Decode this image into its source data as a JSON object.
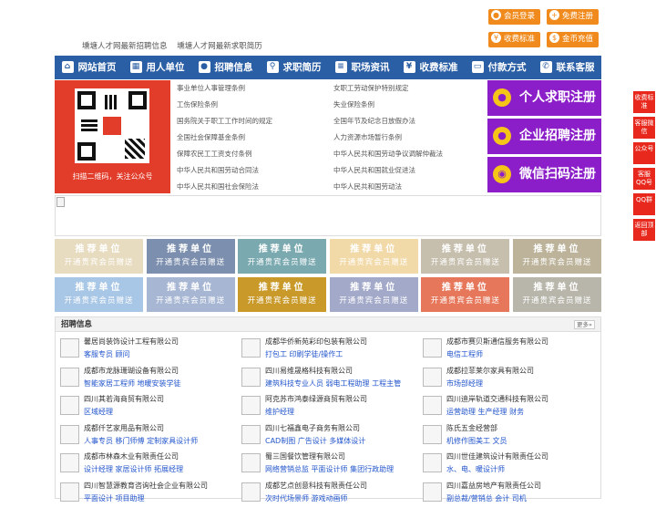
{
  "top_buttons": {
    "member_login": "会员登录",
    "free_register": "免费注册",
    "fee_standard": "收费标准",
    "coin_recharge": "金币充值"
  },
  "top_links": [
    "壎塘人才网最新招聘信息",
    "壎塘人才网最新求职简历"
  ],
  "nav": [
    "网站首页",
    "用人单位",
    "招聘信息",
    "求职简历",
    "职场资讯",
    "收费标准",
    "付款方式",
    "联系客服"
  ],
  "qr_caption": "扫描二维码，关注公众号",
  "laws": [
    [
      "事业单位人事管理条例",
      "女职工劳动保护特别规定"
    ],
    [
      "工伤保险条例",
      "失业保险条例"
    ],
    [
      "国务院关于职工工作时间的规定",
      "全国年节及纪念日放假办法"
    ],
    [
      "全国社会保障基金条例",
      "人力资源市场暂行条例"
    ],
    [
      "保障农民工工资支付条例",
      "中华人民共和国劳动争议调解仲裁法"
    ],
    [
      "中华人民共和国劳动合同法",
      "中华人民共和国就业促进法"
    ],
    [
      "中华人民共和国社会保险法",
      "中华人民共和国劳动法"
    ]
  ],
  "register": {
    "job_seeker": "个人求职注册",
    "company": "企业招聘注册",
    "wechat": "微信扫码注册"
  },
  "recommend": {
    "title": "推荐单位",
    "sub": "开通贵宾会员赠送",
    "colors": [
      "#e8dcc0",
      "#7c8fae",
      "#7aa9b0",
      "#f2d9a8",
      "#c6bfae",
      "#bcb39a",
      "#a8c6e6",
      "#a7b6d3",
      "#c99a2a",
      "#a3a9c9",
      "#e7775a",
      "#b8b6ab"
    ]
  },
  "jobs_section": {
    "title": "招聘信息",
    "more": "更多»",
    "columns": [
      [
        {
          "company": "馨居尚装饰设计工程有限公司",
          "positions": "客服专员  顾问"
        },
        {
          "company": "成都市龙脉珊瑚设备有限公司",
          "positions": "智能家居工程师  地暖安装学徒"
        },
        {
          "company": "四川其若海商贸有限公司",
          "positions": "区域经理"
        },
        {
          "company": "成都仟艺家用品有限公司",
          "positions": "人事专员  移门师傅  定制家具设计师"
        },
        {
          "company": "成都市林森木业有限责任公司",
          "positions": "设计经理  家居设计师  拓展经理"
        },
        {
          "company": "四川智慧源教育咨询社会企业有限公司",
          "positions": "平面设计  项目助理"
        }
      ],
      [
        {
          "company": "成都华侨新苑彩印包装有限公司",
          "positions": "打包工  印刷学徒/操作工"
        },
        {
          "company": "四川易维晟格科技有限公司",
          "positions": "建筑科技专业人员  弱电工程助理  工程主管"
        },
        {
          "company": "阿克苏市鸿泰绿源商贸有限公司",
          "positions": "维护经理"
        },
        {
          "company": "四川七福鑫电子商务有限公司",
          "positions": "CAD制图  广告设计  多媒体设计"
        },
        {
          "company": "蜀三国餐饮管理有限公司",
          "positions": "网络营销总监  平面设计师  集团行政助理"
        },
        {
          "company": "成都艺点创意科技有限责任公司",
          "positions": "次时代场景师  游戏动画师"
        }
      ],
      [
        {
          "company": "成都市赛贝斯通信服务有限公司",
          "positions": "电信工程师"
        },
        {
          "company": "成都拉菲莱尔家具有限公司",
          "positions": "市场部经理"
        },
        {
          "company": "四川迪岸轨道交通科技有限公司",
          "positions": "运营助理  生产经理  财务"
        },
        {
          "company": "陈氏五金经营部",
          "positions": "机修作图美工  文员"
        },
        {
          "company": "四川世佳建筑设计有限责任公司",
          "positions": "水、电、暖设计师"
        },
        {
          "company": "四川嘉益房地产有限责任公司",
          "positions": "副总裁/营销总  会计  司机"
        }
      ]
    ]
  },
  "side_tabs": [
    "收费标准",
    "客服微信",
    "公众号",
    "客服QQ号",
    "QQ群",
    "返回顶部"
  ]
}
